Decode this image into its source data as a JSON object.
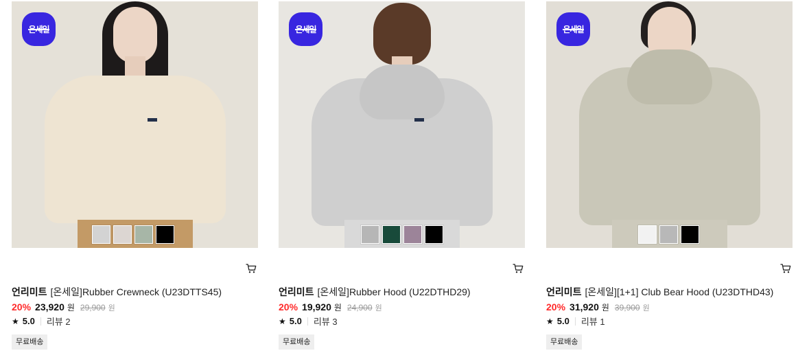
{
  "products": [
    {
      "badge": "온세일",
      "brand": "언리미트",
      "name": "[온세일]Rubber Crewneck (U23DTTS45)",
      "discount": "20%",
      "sale_price": "23,920",
      "sale_unit": "원",
      "original_price": "29,900",
      "original_unit": "원",
      "rating": "5.0",
      "reviews": "리뷰 2",
      "shipping": "무료배송",
      "swatches": [
        "#d3d3d3",
        "#dcd6d2",
        "#a7b6a7",
        "#000000"
      ]
    },
    {
      "badge": "온세일",
      "brand": "언리미트",
      "name": "[온세일]Rubber Hood (U22DTHD29)",
      "discount": "20%",
      "sale_price": "19,920",
      "sale_unit": "원",
      "original_price": "24,900",
      "original_unit": "원",
      "rating": "5.0",
      "reviews": "리뷰 3",
      "shipping": "무료배송",
      "swatches": [
        "#b6b6b6",
        "#184a3a",
        "#9c8499",
        "#000000"
      ]
    },
    {
      "badge": "온세일",
      "brand": "언리미트",
      "name": "[온세일][1+1] Club Bear Hood (U23DTHD43)",
      "discount": "20%",
      "sale_price": "31,920",
      "sale_unit": "원",
      "original_price": "39,900",
      "original_unit": "원",
      "rating": "5.0",
      "reviews": "리뷰 1",
      "shipping": "무료배송",
      "swatches": [
        "#f2f2f2",
        "#b8b8b8",
        "#000000"
      ]
    }
  ]
}
